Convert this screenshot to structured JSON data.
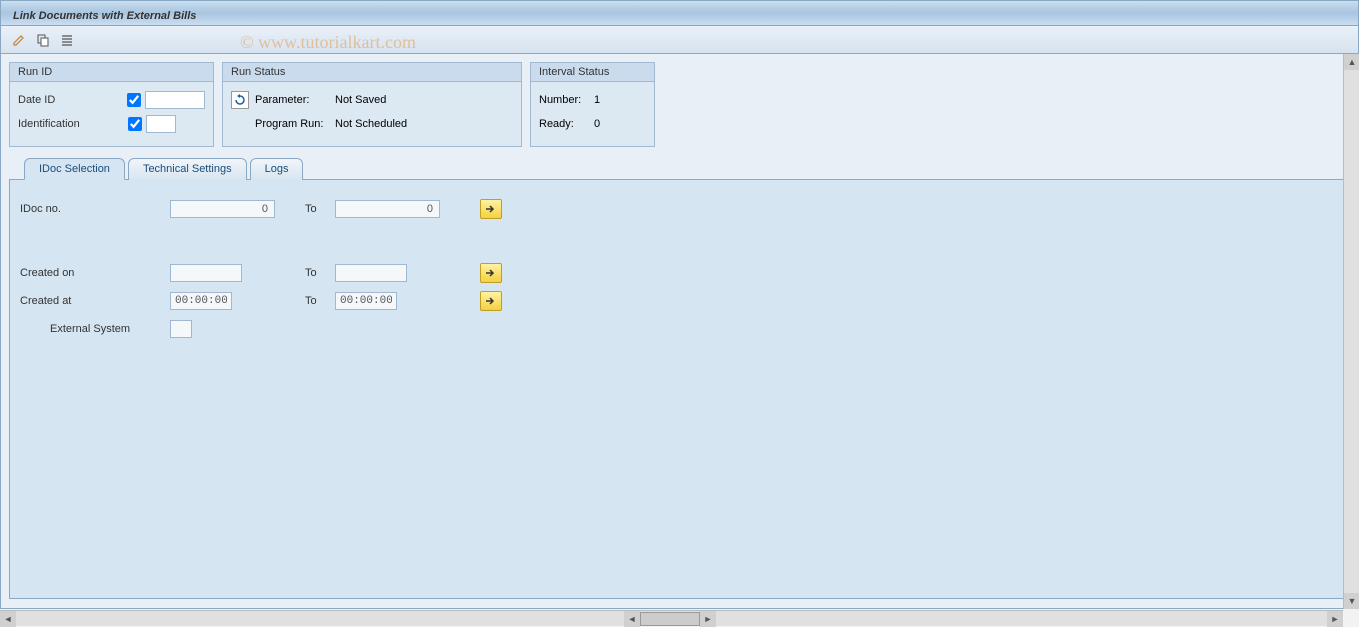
{
  "title": "Link Documents with External Bills",
  "watermark": "© www.tutorialkart.com",
  "panels": {
    "run_id": {
      "header": "Run ID",
      "date_id_label": "Date ID",
      "identification_label": "Identification",
      "date_id_checked": true,
      "identification_checked": true,
      "date_id_value": "",
      "identification_value": ""
    },
    "run_status": {
      "header": "Run Status",
      "parameter_label": "Parameter:",
      "parameter_value": "Not Saved",
      "program_run_label": "Program Run:",
      "program_run_value": "Not Scheduled"
    },
    "interval_status": {
      "header": "Interval Status",
      "number_label": "Number:",
      "number_value": "1",
      "ready_label": "Ready:",
      "ready_value": "0"
    }
  },
  "tabs": [
    {
      "id": "idoc",
      "label": "IDoc Selection",
      "active": true
    },
    {
      "id": "tech",
      "label": "Technical Settings",
      "active": false
    },
    {
      "id": "logs",
      "label": "Logs",
      "active": false
    }
  ],
  "idoc_form": {
    "idoc_no_label": "IDoc no.",
    "idoc_no_from": "0",
    "idoc_no_to_label": "To",
    "idoc_no_to": "0",
    "created_on_label": "Created on",
    "created_on_from": "",
    "created_on_to_label": "To",
    "created_on_to": "",
    "created_at_label": "Created at",
    "created_at_from": "00:00:00",
    "created_at_to_label": "To",
    "created_at_to": "00:00:00",
    "external_system_label": "External System",
    "external_system_value": ""
  }
}
